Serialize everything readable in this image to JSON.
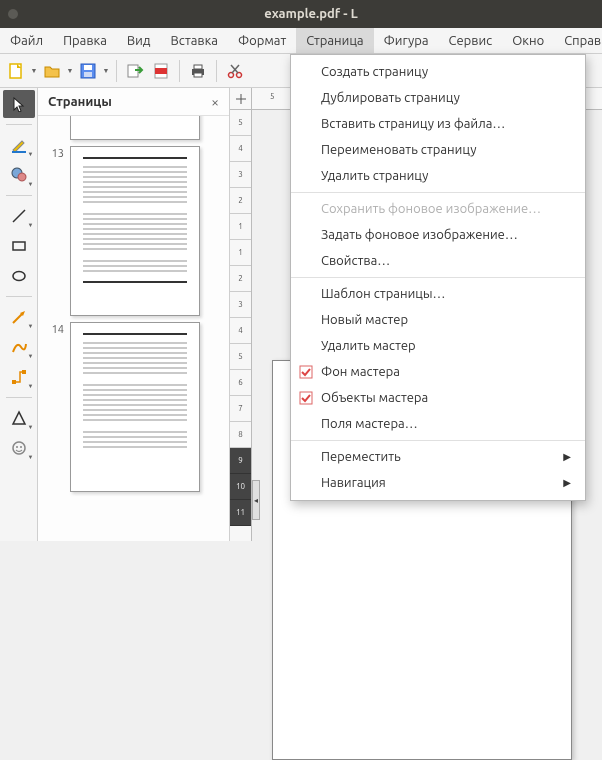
{
  "titlebar": {
    "title": "example.pdf - L"
  },
  "menubar": {
    "items": [
      "Файл",
      "Правка",
      "Вид",
      "Вставка",
      "Формат",
      "Страница",
      "Фигура",
      "Сервис",
      "Окно",
      "Справка"
    ],
    "active_index": 5
  },
  "pages_panel": {
    "title": "Страницы",
    "thumbs": [
      {
        "num": ""
      },
      {
        "num": "13"
      },
      {
        "num": "14"
      }
    ]
  },
  "ruler": {
    "h_start": "5",
    "v_ticks": [
      "5",
      "4",
      "3",
      "2",
      "1",
      "1",
      "2",
      "3",
      "4",
      "5",
      "6",
      "7",
      "8",
      "9",
      "10",
      "11"
    ]
  },
  "dropdown": {
    "items": [
      {
        "label": "Создать страницу",
        "type": "item"
      },
      {
        "label": "Дублировать страницу",
        "type": "item"
      },
      {
        "label": "Вставить страницу из файла…",
        "type": "item"
      },
      {
        "label": "Переименовать страницу",
        "type": "item"
      },
      {
        "label": "Удалить страницу",
        "type": "item"
      },
      {
        "type": "sep"
      },
      {
        "label": "Сохранить фоновое изображение…",
        "type": "item",
        "disabled": true
      },
      {
        "label": "Задать фоновое изображение…",
        "type": "item"
      },
      {
        "label": "Свойства…",
        "type": "item"
      },
      {
        "type": "sep"
      },
      {
        "label": "Шаблон страницы…",
        "type": "item"
      },
      {
        "label": "Новый мастер",
        "type": "item"
      },
      {
        "label": "Удалить мастер",
        "type": "item"
      },
      {
        "label": "Фон мастера",
        "type": "check",
        "checked": true
      },
      {
        "label": "Объекты мастера",
        "type": "check",
        "checked": true
      },
      {
        "label": "Поля мастера…",
        "type": "item"
      },
      {
        "type": "sep"
      },
      {
        "label": "Переместить",
        "type": "submenu"
      },
      {
        "label": "Навигация",
        "type": "submenu"
      }
    ]
  }
}
